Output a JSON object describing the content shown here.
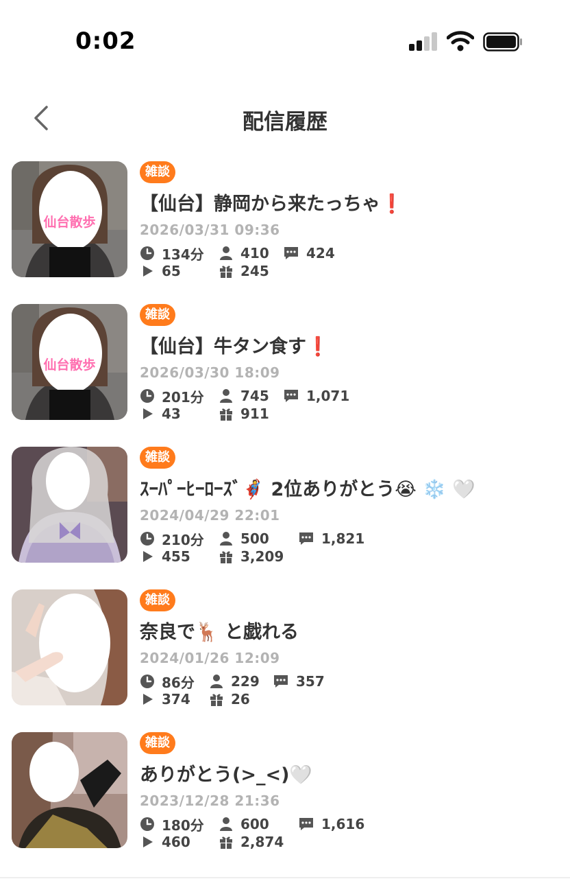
{
  "status_bar": {
    "time": "0:02"
  },
  "nav": {
    "title": "配信履歴"
  },
  "colors": {
    "badge": "#ff7b1c",
    "date": "#b3b3b3",
    "thumb_caption": "#ff6fb0"
  },
  "icons": [
    "clock-icon",
    "person-icon",
    "comment-icon",
    "play-icon",
    "gift-icon"
  ],
  "history": [
    {
      "category": "雑談",
      "thumb_caption": "仙台散歩",
      "title": "【仙台】静岡から来たっちゃ❗",
      "datetime": "2026/03/31 09:36",
      "duration": "134分",
      "viewers": "410",
      "comments": "424",
      "plays": "65",
      "gifts": "245"
    },
    {
      "category": "雑談",
      "thumb_caption": "仙台散歩",
      "title": "【仙台】牛タン食す❗",
      "datetime": "2026/03/30 18:09",
      "duration": "201分",
      "viewers": "745",
      "comments": "1,071",
      "plays": "43",
      "gifts": "911"
    },
    {
      "category": "雑談",
      "title": "ｽｰﾊﾟｰﾋｰﾛｰｽﾞ🦸 2位ありがとう😭 ❄️ 🤍",
      "datetime": "2024/04/29 22:01",
      "duration": "210分",
      "viewers": "500",
      "comments": "1,821",
      "plays": "455",
      "gifts": "3,209"
    },
    {
      "category": "雑談",
      "title": "奈良で🦌 と戯れる",
      "datetime": "2024/01/26 12:09",
      "duration": "86分",
      "viewers": "229",
      "comments": "357",
      "plays": "374",
      "gifts": "26"
    },
    {
      "category": "雑談",
      "title": "ありがとう(>_<)🤍",
      "datetime": "2023/12/28 21:36",
      "duration": "180分",
      "viewers": "600",
      "comments": "1,616",
      "plays": "460",
      "gifts": "2,874"
    }
  ]
}
